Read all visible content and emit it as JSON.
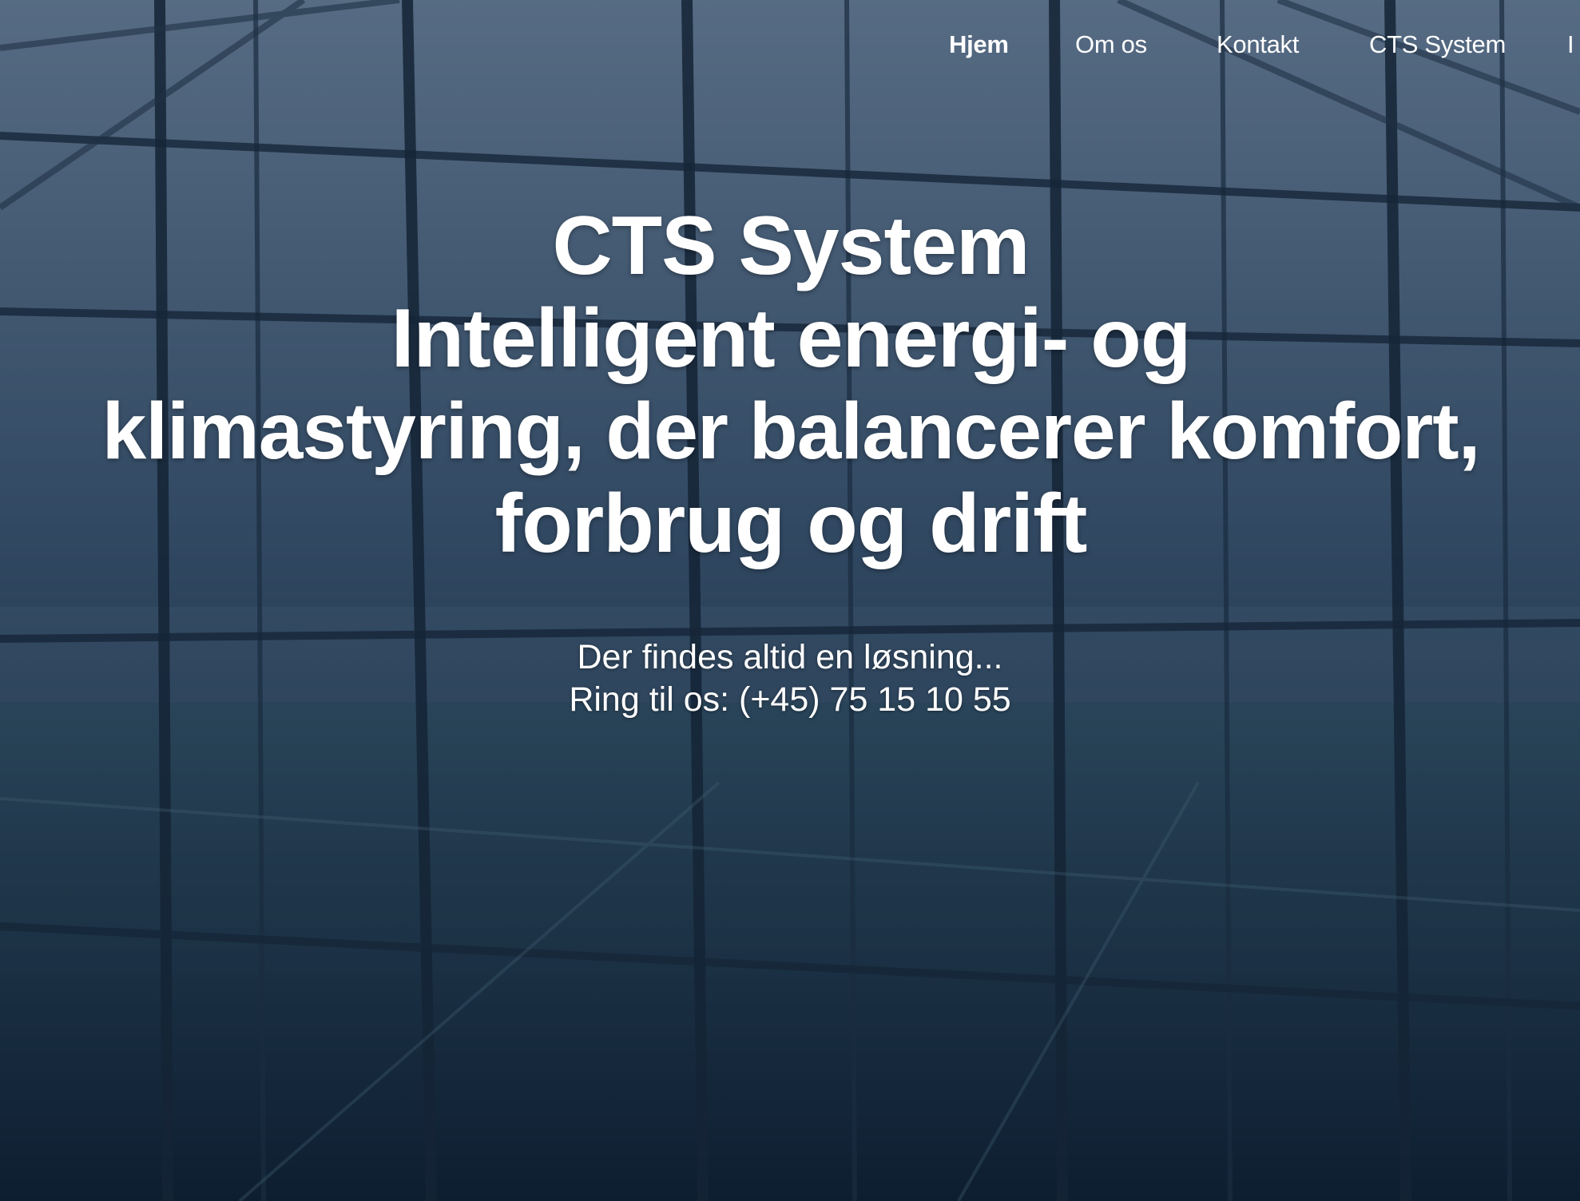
{
  "nav": {
    "items": [
      {
        "label": "Hjem",
        "active": true
      },
      {
        "label": "Om os",
        "active": false
      },
      {
        "label": "Kontakt",
        "active": false
      },
      {
        "label": "CTS System",
        "active": false
      },
      {
        "label": "I",
        "active": false
      }
    ]
  },
  "hero": {
    "title_lines": [
      "CTS System",
      "Intelligent energi- og",
      "klimastyring, der balancerer komfort,",
      "forbrug og drift"
    ],
    "subtitle": "Der findes altid en løsning...",
    "phone_line": "Ring til os: (+45) 75 15 10 55"
  },
  "colors": {
    "text": "#ffffff",
    "overlay": "#0b1a2c"
  }
}
